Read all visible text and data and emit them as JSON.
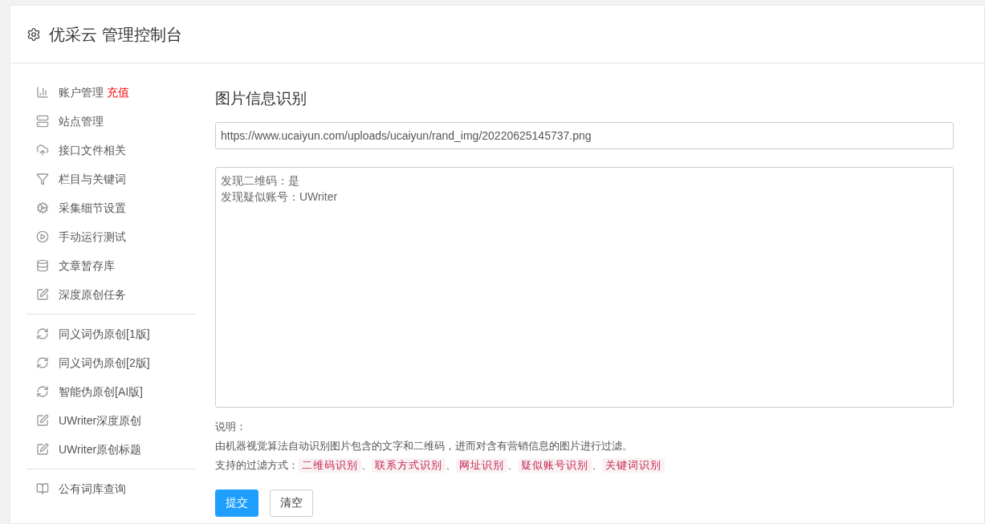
{
  "header": {
    "title": "优采云 管理控制台"
  },
  "sidebar": {
    "groups": [
      {
        "items": [
          {
            "label": "账户管理",
            "badge": "充值"
          },
          {
            "label": "站点管理"
          },
          {
            "label": "接口文件相关"
          },
          {
            "label": "栏目与关键词"
          },
          {
            "label": "采集细节设置"
          },
          {
            "label": "手动运行测试"
          },
          {
            "label": "文章暂存库"
          },
          {
            "label": "深度原创任务"
          }
        ]
      },
      {
        "items": [
          {
            "label": "同义词伪原创[1版]"
          },
          {
            "label": "同义词伪原创[2版]"
          },
          {
            "label": "智能伪原创[AI版]"
          },
          {
            "label": "UWriter深度原创"
          },
          {
            "label": "UWriter原创标题"
          }
        ]
      },
      {
        "items": [
          {
            "label": "公有词库查询"
          }
        ]
      }
    ]
  },
  "main": {
    "title": "图片信息识别",
    "url_field": {
      "value": "https://www.ucaiyun.com/uploads/ucaiyun/rand_img/20220625145737.png"
    },
    "result_lines": [
      "发现二维码：是",
      "发现疑似账号：UWriter"
    ],
    "note_label": "说明：",
    "note_text": "由机器视觉算法自动识别图片包含的文字和二维码，进而对含有营销信息的图片进行过滤。",
    "methods_label": "支持的过滤方式：",
    "methods": [
      "二维码识别",
      "联系方式识别",
      "网址识别",
      "疑似账号识别",
      "关键词识别"
    ],
    "separator": "、",
    "buttons": [
      {
        "label": "提交",
        "kind": "primary"
      },
      {
        "label": "清空",
        "kind": "default"
      }
    ]
  }
}
